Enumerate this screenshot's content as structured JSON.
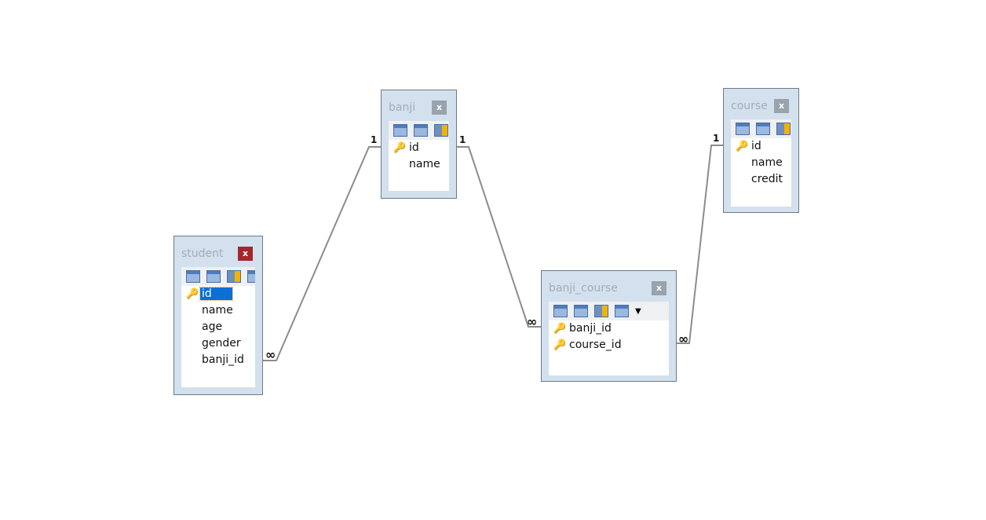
{
  "tables": [
    {
      "name": "student",
      "active": true,
      "fields": [
        {
          "name": "id",
          "pk": true,
          "selected": true
        },
        {
          "name": "name"
        },
        {
          "name": "age"
        },
        {
          "name": "gender"
        },
        {
          "name": "banji_id"
        }
      ],
      "close_label": "x"
    },
    {
      "name": "banji",
      "fields": [
        {
          "name": "id",
          "pk": true
        },
        {
          "name": "name"
        }
      ],
      "close_label": "x"
    },
    {
      "name": "course",
      "fields": [
        {
          "name": "id",
          "pk": true
        },
        {
          "name": "name"
        },
        {
          "name": "credit"
        }
      ],
      "close_label": "x"
    },
    {
      "name": "banji_course",
      "fields": [
        {
          "name": "banji_id",
          "pk": true
        },
        {
          "name": "course_id",
          "pk": true
        }
      ],
      "close_label": "x"
    }
  ],
  "relationships": [
    {
      "from": "student.banji_id",
      "to": "banji.id",
      "many_label": "∞",
      "one_label": "1"
    },
    {
      "from": "banji_course.banji_id",
      "to": "banji.id",
      "many_label": "∞",
      "one_label": "1"
    },
    {
      "from": "banji_course.course_id",
      "to": "course.id",
      "many_label": "∞",
      "one_label": "1"
    }
  ],
  "colors": {
    "active_close": "#a3272c",
    "selection": "#0a6fd6",
    "key": "#e0a800"
  }
}
